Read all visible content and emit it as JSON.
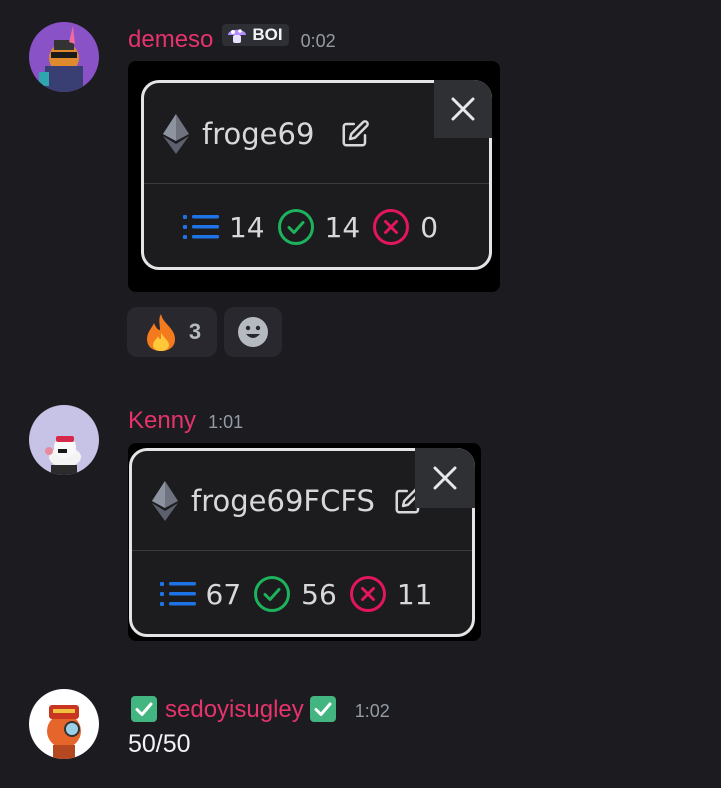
{
  "messages": [
    {
      "username": "demeso",
      "tag": "BOI",
      "time": "0:02",
      "card": {
        "name": "froge69",
        "total": "14",
        "success": "14",
        "failed": "0"
      },
      "reactions": [
        {
          "emoji": "🔥",
          "count": "3"
        }
      ]
    },
    {
      "username": "Kenny",
      "time": "1:01",
      "card": {
        "name": "froge69FCFS",
        "total": "67",
        "success": "56",
        "failed": "11"
      }
    },
    {
      "username": "sedoyisugley",
      "time": "1:02",
      "text": "50/50"
    }
  ],
  "colors": {
    "background": "#1b1b20",
    "username": "#e6336b",
    "list_icon": "#1e74e6",
    "success": "#1cb35c",
    "failed": "#e3165b"
  },
  "icons": [
    "ethereum-icon",
    "edit-icon",
    "close-icon",
    "list-icon",
    "check-circle-icon",
    "x-circle-icon",
    "add-reaction-icon",
    "check-box-emoji"
  ]
}
